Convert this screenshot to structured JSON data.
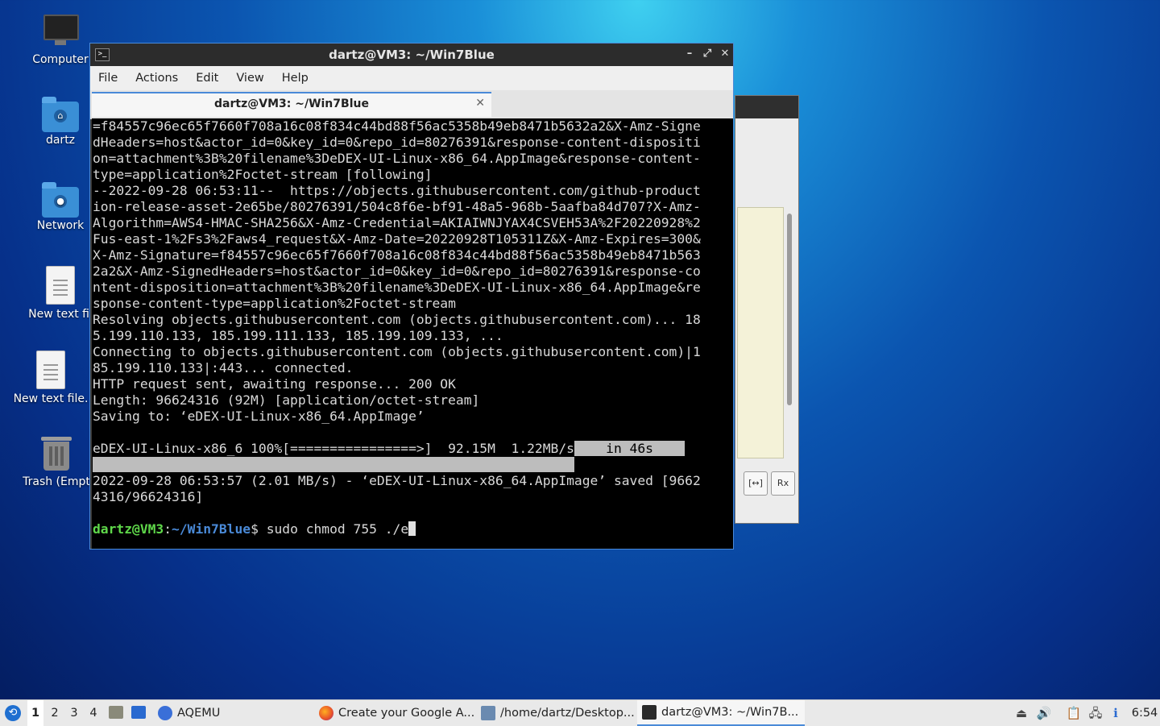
{
  "desktop": {
    "icons": [
      {
        "label": "Computer",
        "kind": "monitor"
      },
      {
        "label": "dartz",
        "kind": "home-folder"
      },
      {
        "label": "Network",
        "kind": "network-folder"
      },
      {
        "label": "New text fil",
        "kind": "text-file"
      },
      {
        "label": "New text file.",
        "kind": "text-file"
      },
      {
        "label": "Trash (Empt",
        "kind": "trash"
      }
    ]
  },
  "terminal": {
    "title": "dartz@VM3: ~/Win7Blue",
    "menu": [
      "File",
      "Actions",
      "Edit",
      "View",
      "Help"
    ],
    "tab_label": "dartz@VM3: ~/Win7Blue",
    "lines": [
      "=f84557c96ec65f7660f708a16c08f834c44bd88f56ac5358b49eb8471b5632a2&X-Amz-Signe",
      "dHeaders=host&actor_id=0&key_id=0&repo_id=80276391&response-content-dispositi",
      "on=attachment%3B%20filename%3DeDEX-UI-Linux-x86_64.AppImage&response-content-",
      "type=application%2Foctet-stream [following]",
      "--2022-09-28 06:53:11--  https://objects.githubusercontent.com/github-product",
      "ion-release-asset-2e65be/80276391/504c8f6e-bf91-48a5-968b-5aafba84d707?X-Amz-",
      "Algorithm=AWS4-HMAC-SHA256&X-Amz-Credential=AKIAIWNJYAX4CSVEH53A%2F20220928%2",
      "Fus-east-1%2Fs3%2Faws4_request&X-Amz-Date=20220928T105311Z&X-Amz-Expires=300&",
      "X-Amz-Signature=f84557c96ec65f7660f708a16c08f834c44bd88f56ac5358b49eb8471b563",
      "2a2&X-Amz-SignedHeaders=host&actor_id=0&key_id=0&repo_id=80276391&response-co",
      "ntent-disposition=attachment%3B%20filename%3DeDEX-UI-Linux-x86_64.AppImage&re",
      "sponse-content-type=application%2Foctet-stream",
      "Resolving objects.githubusercontent.com (objects.githubusercontent.com)... 18",
      "5.199.110.133, 185.199.111.133, 185.199.109.133, ...",
      "Connecting to objects.githubusercontent.com (objects.githubusercontent.com)|1",
      "85.199.110.133|:443... connected.",
      "HTTP request sent, awaiting response... 200 OK",
      "Length: 96624316 (92M) [application/octet-stream]",
      "Saving to: ‘eDEX-UI-Linux-x86_64.AppImage’",
      ""
    ],
    "progress_text": "eDEX-UI-Linux-x86_6 100%[================>]  92.15M  1.22MB/s",
    "progress_time": "    in 46s    ",
    "progress_blank": "                                                             ",
    "saved_lines": [
      "2022-09-28 06:53:57 (2.01 MB/s) - ‘eDEX-UI-Linux-x86_64.AppImage’ saved [9662",
      "4316/96624316]",
      ""
    ],
    "prompt_user": "dartz@VM3",
    "prompt_sep": ":",
    "prompt_path": "~/Win7Blue",
    "prompt_symbol": "$",
    "command": " sudo chmod 755 ./e"
  },
  "bg_window": {
    "buttons": [
      "[↔]",
      "Rx"
    ]
  },
  "taskbar": {
    "workspaces": [
      "1",
      "2",
      "3",
      "4"
    ],
    "active_workspace": "1",
    "tasks": [
      {
        "label": "AQEMU",
        "icon": "aqemu-icon"
      },
      {
        "label": "Create your Google A...",
        "icon": "firefox-icon"
      },
      {
        "label": "/home/dartz/Desktop...",
        "icon": "text-editor-icon"
      },
      {
        "label": "dartz@VM3: ~/Win7B...",
        "icon": "terminal-icon"
      }
    ],
    "clock": "6:54"
  }
}
